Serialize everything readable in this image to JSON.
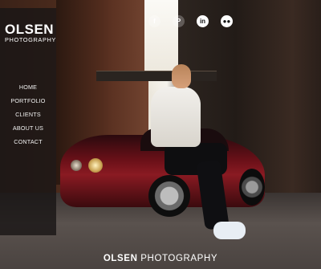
{
  "brand": {
    "logo_main": "OLSEN",
    "logo_sub": "PHOTOGRAPHY",
    "footer_bold": "OLSEN",
    "footer_regular": "PHOTOGRAPHY"
  },
  "nav": {
    "items": [
      {
        "label": "HOME"
      },
      {
        "label": "PORTFOLIO"
      },
      {
        "label": "CLIENTS"
      },
      {
        "label": "ABOUT US"
      },
      {
        "label": "CONTACT"
      }
    ]
  },
  "social": {
    "icons": [
      {
        "name": "facebook-icon",
        "glyph": "f"
      },
      {
        "name": "pinterest-icon",
        "glyph": "P"
      },
      {
        "name": "linkedin-icon",
        "glyph": "in"
      },
      {
        "name": "flickr-icon",
        "glyph": "●●"
      }
    ]
  },
  "colors": {
    "sidebar_bg": "#1a1616",
    "text": "#ffffff"
  }
}
